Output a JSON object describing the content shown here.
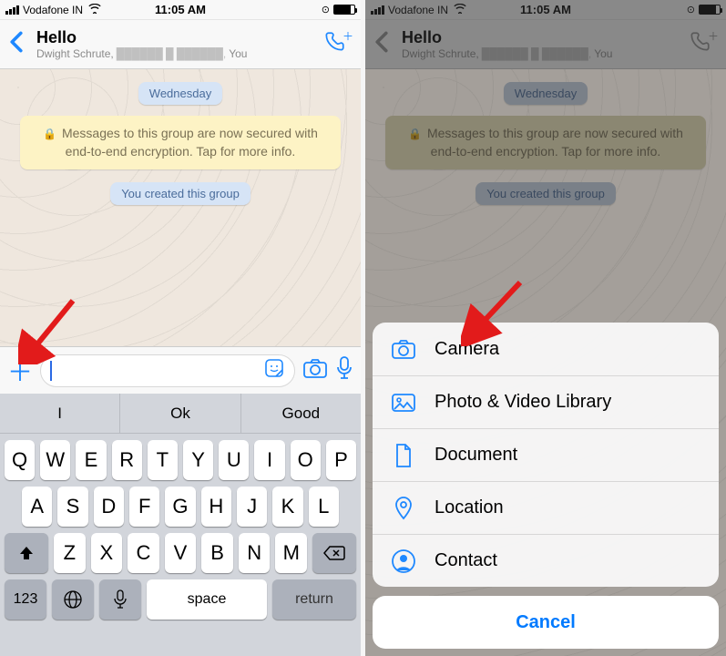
{
  "status": {
    "carrier": "Vodafone IN",
    "time": "11:05 AM"
  },
  "header": {
    "title": "Hello",
    "subtitle_name": "Dwight Schrute,",
    "subtitle_blur": "██████ █ ██████,",
    "subtitle_you": "You"
  },
  "chat": {
    "date_label": "Wednesday",
    "encryption_info": "Messages to this group are now secured with end-to-end encryption. Tap for more info.",
    "system_msg": "You created this group"
  },
  "keyboard": {
    "suggestions": [
      "I",
      "Ok",
      "Good"
    ],
    "row1": [
      "Q",
      "W",
      "E",
      "R",
      "T",
      "Y",
      "U",
      "I",
      "O",
      "P"
    ],
    "row2": [
      "A",
      "S",
      "D",
      "F",
      "G",
      "H",
      "J",
      "K",
      "L"
    ],
    "row3": [
      "Z",
      "X",
      "C",
      "V",
      "B",
      "N",
      "M"
    ],
    "numeric_label": "123",
    "space_label": "space",
    "return_label": "return"
  },
  "action_sheet": {
    "items": [
      {
        "icon": "camera",
        "label": "Camera"
      },
      {
        "icon": "gallery",
        "label": "Photo & Video Library"
      },
      {
        "icon": "document",
        "label": "Document"
      },
      {
        "icon": "location",
        "label": "Location"
      },
      {
        "icon": "contact",
        "label": "Contact"
      }
    ],
    "cancel": "Cancel"
  }
}
